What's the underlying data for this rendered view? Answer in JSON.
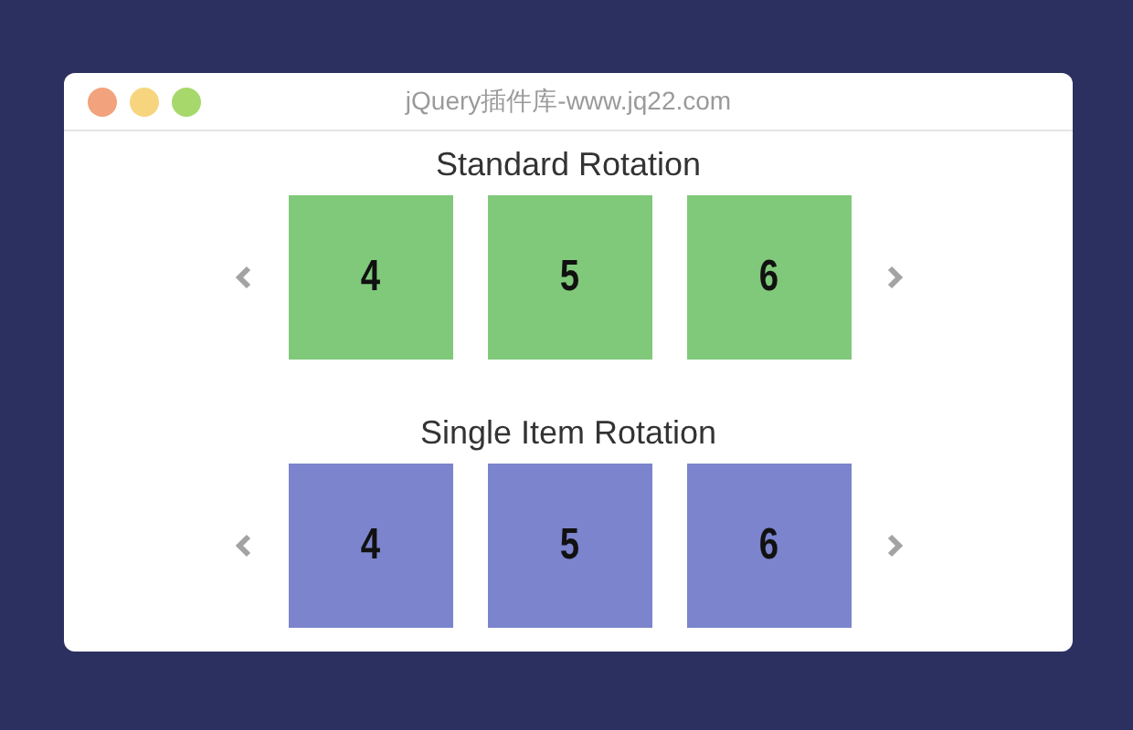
{
  "window": {
    "title": "jQuery插件库-www.jq22.com"
  },
  "carousels": [
    {
      "title": "Standard Rotation",
      "color": "#80c97a",
      "items": [
        "4",
        "5",
        "6"
      ]
    },
    {
      "title": "Single Item Rotation",
      "color": "#7b84cc",
      "items": [
        "4",
        "5",
        "6"
      ]
    }
  ]
}
